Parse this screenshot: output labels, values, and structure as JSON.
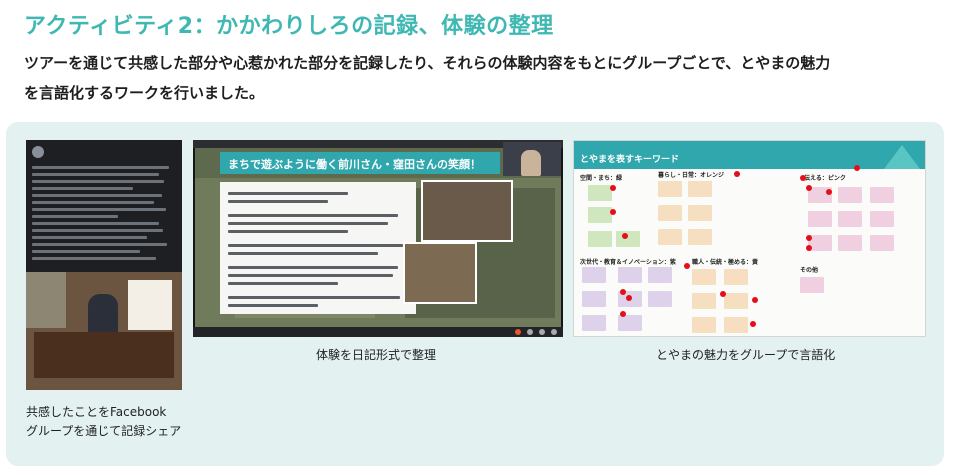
{
  "header": {
    "title": "アクティビティ2：かかわりしろの記録、体験の整理",
    "lead_line1": "ツアーを通じて共感した部分や心惹かれた部分を記録したり、それらの体験内容をもとにグループごとで、とやまの魅力",
    "lead_line2": "を言語化するワークを行いました。"
  },
  "colors": {
    "accent": "#3fb8b3",
    "panel_bg": "#e3f1f1",
    "dot": "#e40f1a"
  },
  "figures": [
    {
      "name": "facebook-post",
      "caption_line1": "共感したことをFacebook",
      "caption_line2": "グループを通じて記録シェア"
    },
    {
      "name": "diary-slide",
      "caption": "体験を日記形式で整理",
      "banner": "まちで遊ぶように働く前川さん・窪田さんの笑顔！"
    },
    {
      "name": "keyword-board",
      "caption": "とやまの魅力をグループで言語化",
      "board_title": "とやまを表すキーワード",
      "groups": [
        "空間・まち：緑",
        "暮らし・日常：オレンジ",
        "伝える：ピンク",
        "次世代・教育＆イノベーション：紫",
        "職人・伝統・極める：黄",
        "その他"
      ]
    }
  ]
}
